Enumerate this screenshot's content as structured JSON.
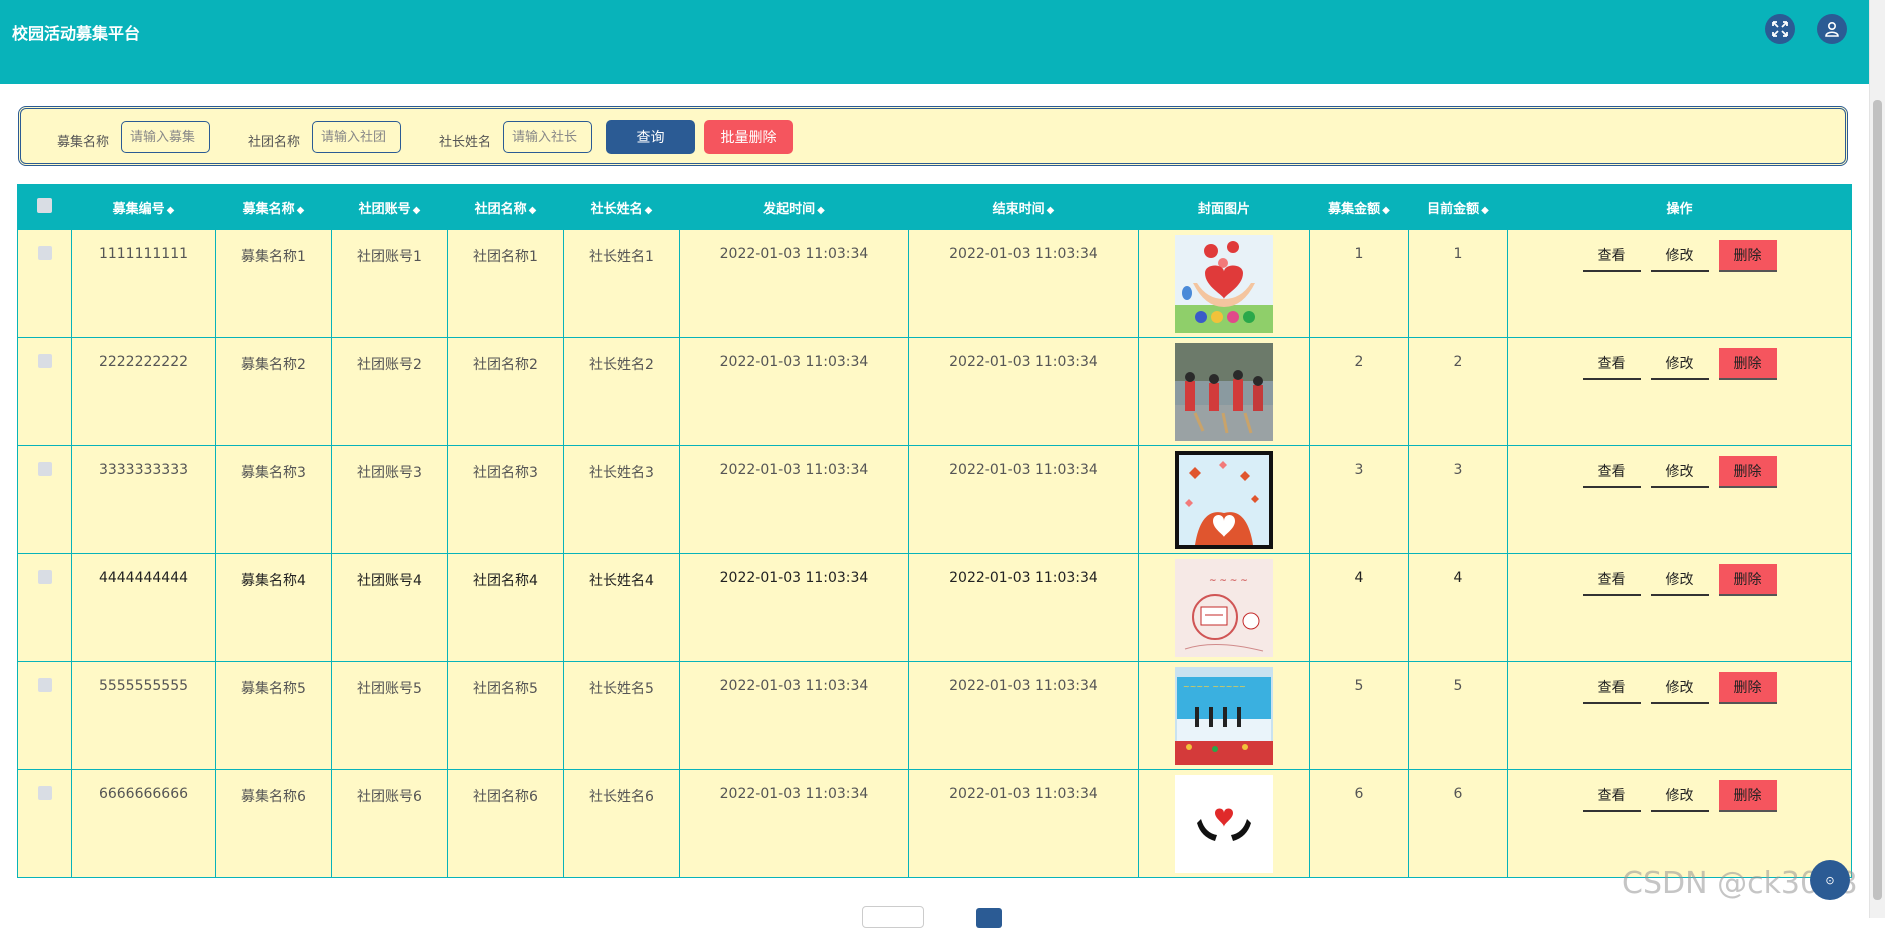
{
  "app": {
    "title": "校园活动募集平台"
  },
  "header_icons": [
    "fullscreen-icon",
    "user-icon"
  ],
  "search": {
    "fields": [
      {
        "label": "募集名称",
        "placeholder": "请输入募集"
      },
      {
        "label": "社团名称",
        "placeholder": "请输入社团"
      },
      {
        "label": "社长姓名",
        "placeholder": "请输入社长"
      }
    ],
    "query_label": "查询",
    "batch_delete_label": "批量删除"
  },
  "table": {
    "columns": [
      "募集编号",
      "募集名称",
      "社团账号",
      "社团名称",
      "社长姓名",
      "发起时间",
      "结束时间",
      "封面图片",
      "募集金额",
      "目前金额",
      "操作"
    ],
    "sortable": [
      true,
      true,
      true,
      true,
      true,
      true,
      true,
      false,
      true,
      true,
      false
    ],
    "rows": [
      {
        "id": "1111111111",
        "name": "募集名称1",
        "account": "社团账号1",
        "club": "社团名称1",
        "leader": "社长姓名1",
        "start": "2022-01-03 11:03:34",
        "end": "2022-01-03 11:03:34",
        "image": "hearts-hands-kids",
        "amount": "1",
        "current": "1"
      },
      {
        "id": "2222222222",
        "name": "募集名称2",
        "account": "社团账号2",
        "club": "社团名称2",
        "leader": "社长姓名2",
        "start": "2022-01-03 11:03:34",
        "end": "2022-01-03 11:03:34",
        "image": "volunteers-sweeping",
        "amount": "2",
        "current": "2"
      },
      {
        "id": "3333333333",
        "name": "募集名称3",
        "account": "社团账号3",
        "club": "社团名称3",
        "leader": "社长姓名3",
        "start": "2022-01-03 11:03:34",
        "end": "2022-01-03 11:03:34",
        "image": "heart-hands-butterflies",
        "amount": "3",
        "current": "3"
      },
      {
        "id": "4444444444",
        "name": "募集名称4",
        "account": "社团账号4",
        "club": "社团名称4",
        "leader": "社长姓名4",
        "start": "2022-01-03 11:03:34",
        "end": "2022-01-03 11:03:34",
        "image": "charity-poster",
        "amount": "4",
        "current": "4"
      },
      {
        "id": "5555555555",
        "name": "募集名称5",
        "account": "社团账号5",
        "club": "社团名称5",
        "leader": "社长姓名5",
        "start": "2022-01-03 11:03:34",
        "end": "2022-01-03 11:03:34",
        "image": "outdoor-event-stage",
        "amount": "5",
        "current": "5"
      },
      {
        "id": "6666666666",
        "name": "募集名称6",
        "account": "社团账号6",
        "club": "社团名称6",
        "leader": "社长姓名6",
        "start": "2022-01-03 11:03:34",
        "end": "2022-01-03 11:03:34",
        "image": "hands-holding-heart",
        "amount": "6",
        "current": "6"
      }
    ],
    "actions": {
      "view": "查看",
      "edit": "修改",
      "delete": "删除"
    }
  },
  "watermark": "CSDN @ck3018",
  "colors": {
    "header": "#08b3ba",
    "panel": "#fff9c6",
    "primary": "#2b5b94",
    "danger": "#f5555e"
  }
}
